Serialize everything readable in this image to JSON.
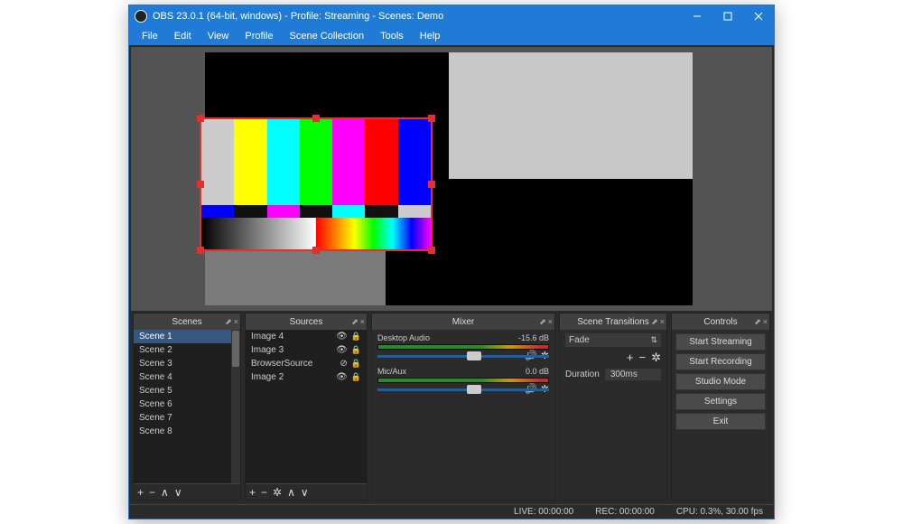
{
  "titlebar": {
    "title": "OBS 23.0.1 (64-bit, windows) - Profile: Streaming - Scenes: Demo"
  },
  "menu": {
    "file": "File",
    "edit": "Edit",
    "view": "View",
    "profile": "Profile",
    "scene_collection": "Scene Collection",
    "tools": "Tools",
    "help": "Help"
  },
  "scenes": {
    "title": "Scenes",
    "items": [
      "Scene 1",
      "Scene 2",
      "Scene 3",
      "Scene 4",
      "Scene 5",
      "Scene 6",
      "Scene 7",
      "Scene 8"
    ],
    "selected_index": 0
  },
  "sources": {
    "title": "Sources",
    "items": [
      {
        "name": "Image 4",
        "visible": true,
        "locked": true
      },
      {
        "name": "Image 3",
        "visible": true,
        "locked": true
      },
      {
        "name": "BrowserSource",
        "visible": false,
        "locked": true
      },
      {
        "name": "Image 2",
        "visible": true,
        "locked": true
      }
    ]
  },
  "mixer": {
    "title": "Mixer",
    "channels": [
      {
        "name": "Desktop Audio",
        "level": "-15.6 dB",
        "slider": 0.52
      },
      {
        "name": "Mic/Aux",
        "level": "0.0 dB",
        "slider": 0.52
      }
    ]
  },
  "transitions": {
    "title": "Scene Transitions",
    "selected": "Fade",
    "duration_label": "Duration",
    "duration_value": "300ms"
  },
  "controls": {
    "title": "Controls",
    "buttons": [
      "Start Streaming",
      "Start Recording",
      "Studio Mode",
      "Settings",
      "Exit"
    ]
  },
  "status": {
    "live": "LIVE: 00:00:00",
    "rec": "REC: 00:00:00",
    "cpu": "CPU: 0.3%, 30.00 fps"
  }
}
